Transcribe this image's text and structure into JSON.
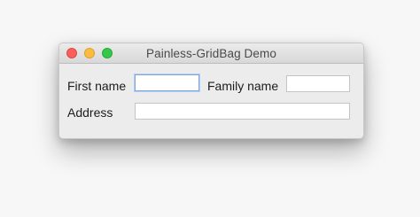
{
  "window": {
    "title": "Painless-GridBag Demo",
    "traffic_lights": {
      "close_color": "#fc605b",
      "minimize_color": "#fdbc40",
      "zoom_color": "#34c84a"
    }
  },
  "form": {
    "first_name": {
      "label": "First name",
      "value": "",
      "placeholder": "",
      "focused": true
    },
    "family_name": {
      "label": "Family name",
      "value": "",
      "placeholder": ""
    },
    "address": {
      "label": "Address",
      "value": "",
      "placeholder": ""
    }
  }
}
